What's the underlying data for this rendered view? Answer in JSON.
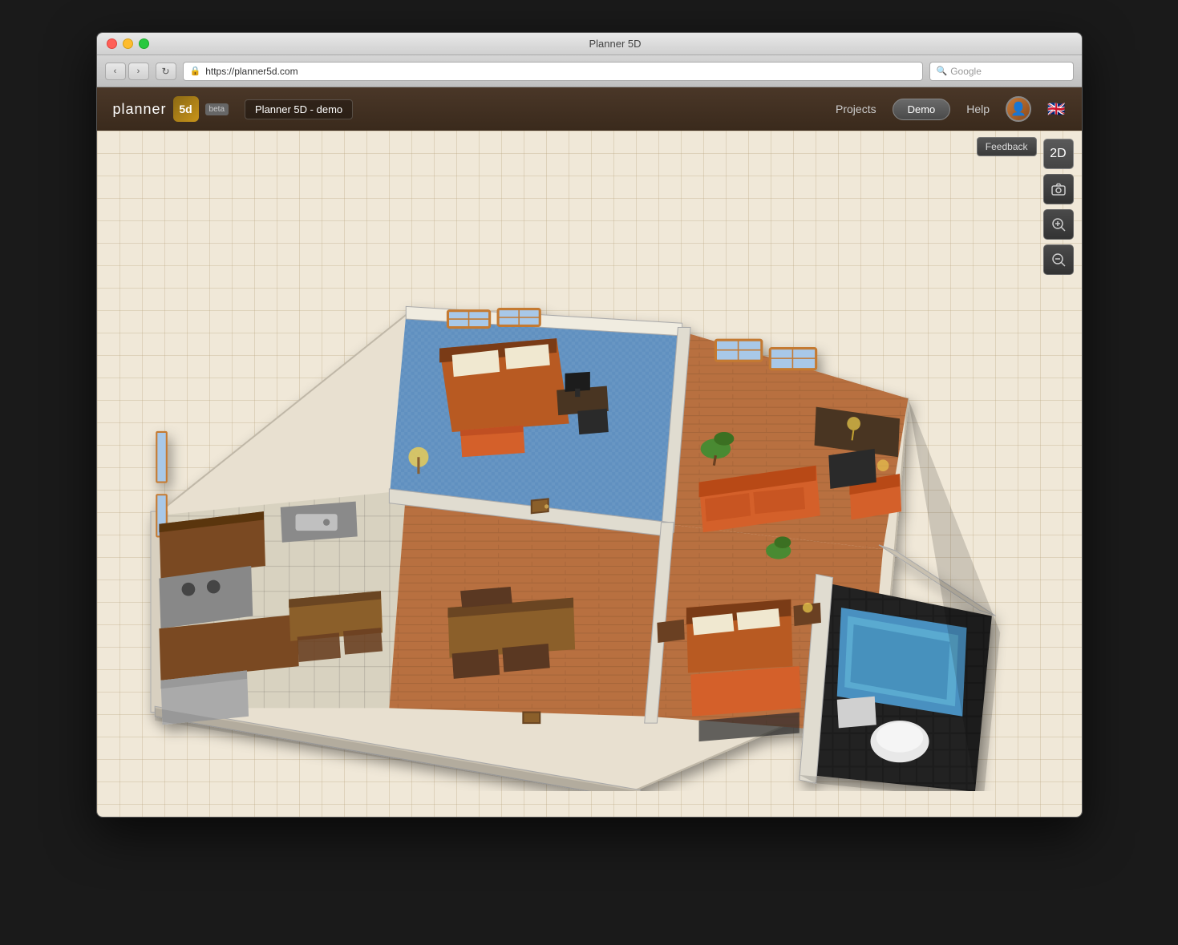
{
  "window": {
    "title": "Planner 5D"
  },
  "browser": {
    "back_label": "‹",
    "forward_label": "›",
    "reload_label": "↻",
    "address": "https://planner5d.com",
    "search_placeholder": "Google"
  },
  "header": {
    "logo_text": "planner",
    "logo_box": "5d",
    "beta_label": "beta",
    "project_name": "Planner 5D - demo",
    "nav_projects": "Projects",
    "nav_demo": "Demo",
    "nav_help": "Help"
  },
  "toolbar": {
    "feedback_label": "Feedback",
    "btn_2d": "2D",
    "btn_camera": "📷",
    "btn_zoom_in": "🔍+",
    "btn_zoom_out": "🔍-"
  },
  "colors": {
    "header_bg": "#3d2a1a",
    "grid_bg": "#f0e8d8",
    "wall_color": "#e8e0d0",
    "floor_wood": "#b87040",
    "floor_tile": "#d4cfc0",
    "furniture_orange": "#d4602a",
    "furniture_dark": "#5a3a1a"
  }
}
